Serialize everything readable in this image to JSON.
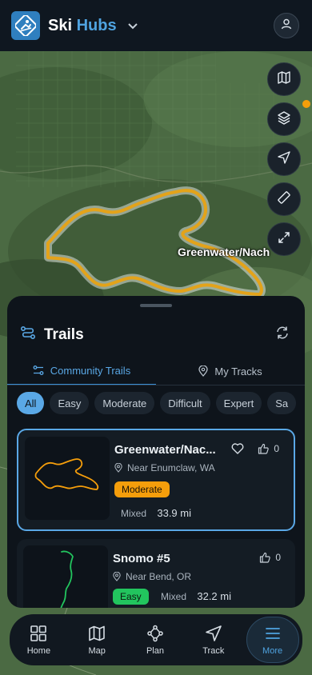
{
  "app": {
    "brand_primary": "Ski",
    "brand_accent": "Hubs",
    "accent_color": "#4fa3e0"
  },
  "map": {
    "route_label": "Greenwater/Nach",
    "controls": [
      "map-layers-icon",
      "stack-icon",
      "navigate-icon",
      "ruler-icon",
      "expand-icon"
    ]
  },
  "sheet": {
    "title": "Trails",
    "tabs": [
      {
        "label": "Community Trails",
        "icon": "filter-icon",
        "active": true
      },
      {
        "label": "My Tracks",
        "icon": "pin-icon",
        "active": false
      }
    ],
    "filters": [
      "All",
      "Easy",
      "Moderate",
      "Difficult",
      "Expert",
      "Sa"
    ],
    "active_filter": "All",
    "trails": [
      {
        "name": "Greenwater/Nac...",
        "location": "Near Enumclaw, WA",
        "difficulty": "Moderate",
        "surface": "Mixed",
        "distance": "33.9 mi",
        "likes": "0",
        "route_color": "#f59e0b"
      },
      {
        "name": "Snomo #5",
        "location": "Near Bend, OR",
        "difficulty": "Easy",
        "surface": "Mixed",
        "distance": "32.2 mi",
        "likes": "0",
        "route_color": "#22c55e"
      }
    ]
  },
  "nav": {
    "items": [
      {
        "label": "Home",
        "icon": "grid-icon"
      },
      {
        "label": "Map",
        "icon": "map-icon"
      },
      {
        "label": "Plan",
        "icon": "route-icon"
      },
      {
        "label": "Track",
        "icon": "navigate-icon"
      },
      {
        "label": "More",
        "icon": "menu-icon",
        "active": true
      }
    ]
  }
}
